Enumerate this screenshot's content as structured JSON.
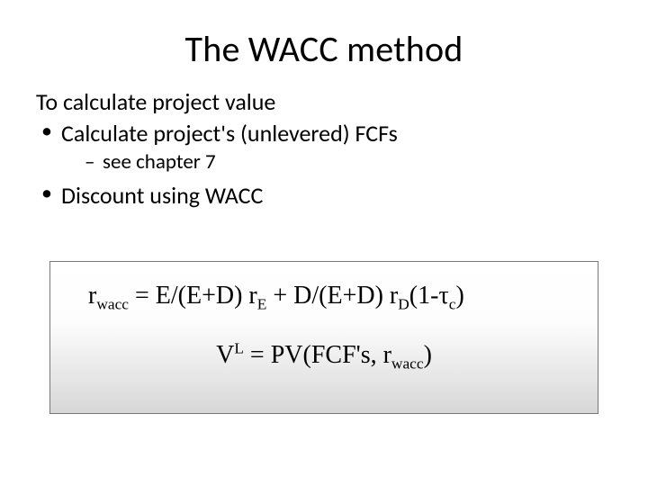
{
  "title": "The WACC method",
  "intro": "To calculate project value",
  "bullet1": "Calculate  project's (unlevered) FCFs",
  "sub1": "see chapter 7",
  "bullet2": "Discount using WACC",
  "formula": {
    "r": "r",
    "wacc": "wacc",
    "eq": " = E/(E+D) r",
    "E": "E",
    "plus": " + D/(E+D) r",
    "D": "D",
    "open": "(1-",
    "tau": "τ",
    "c": "c",
    "close": ")",
    "V": "V",
    "L": "L",
    "eq2": " = PV(FCF's, r",
    "close2": ")"
  }
}
